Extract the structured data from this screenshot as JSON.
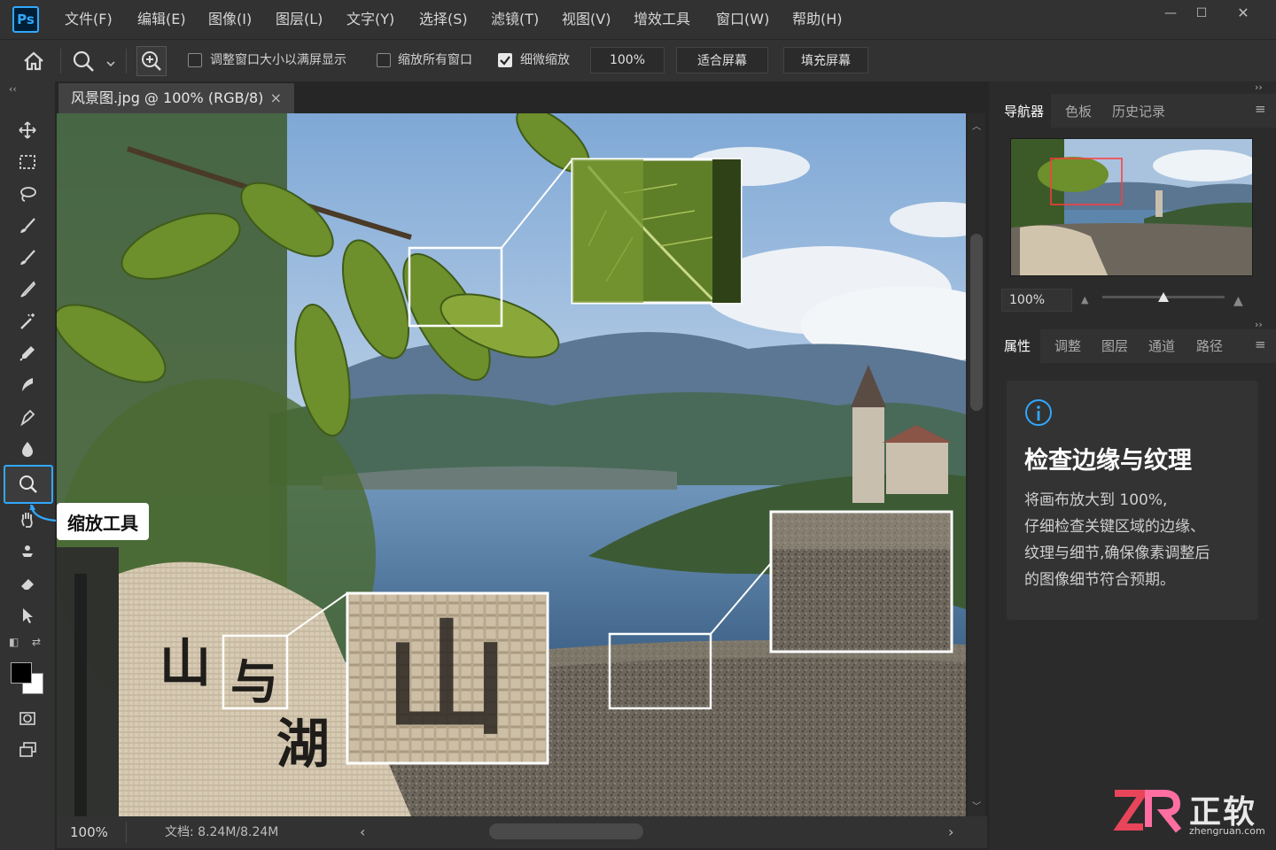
{
  "app": {
    "logo": "Ps"
  },
  "menu": [
    "文件(F)",
    "编辑(E)",
    "图像(I)",
    "图层(L)",
    "文字(Y)",
    "选择(S)",
    "滤镜(T)",
    "视图(V)",
    "增效工具",
    "窗口(W)",
    "帮助(H)"
  ],
  "window_controls": {
    "minimize": "—",
    "maximize": "☐",
    "close": "✕"
  },
  "options": {
    "resize_windows": {
      "label": "调整窗口大小以满屏显示",
      "checked": false
    },
    "zoom_all": {
      "label": "缩放所有窗口",
      "checked": false
    },
    "scrubby_zoom": {
      "label": "细微缩放",
      "checked": true
    },
    "zoom_value": "100%",
    "fit_screen": "适合屏幕",
    "fill_screen": "填充屏幕"
  },
  "document": {
    "tab_title": "风景图.jpg @ 100% (RGB/8)",
    "close": "×"
  },
  "canvas_text": {
    "wall_chars": [
      "山",
      "与",
      "湖"
    ],
    "zoom_char": "山"
  },
  "tooltip": {
    "label": "缩放工具"
  },
  "status": {
    "zoom": "100%",
    "doc_size": "文档: 8.24M/8.24M"
  },
  "panels": {
    "top_tabs": [
      "导航器",
      "色板",
      "历史记录"
    ],
    "navigator_zoom": "100%",
    "navigator_level": 0.5,
    "bottom_tabs": [
      "属性",
      "调整",
      "图层",
      "通道",
      "路径"
    ]
  },
  "info": {
    "title": "检查边缘与纹理",
    "lines": [
      "将画布放大到 100%,",
      "仔细检查关键区域的边缘、",
      "纹理与细节,确保像素调整后",
      "的图像细节符合预期。"
    ]
  },
  "watermark": {
    "brand": "正软",
    "url": "zhengruan.com"
  },
  "colors": {
    "accent": "#31a8ff",
    "watermark_red": "#e8455a",
    "watermark_pink": "#ff6ea0"
  }
}
